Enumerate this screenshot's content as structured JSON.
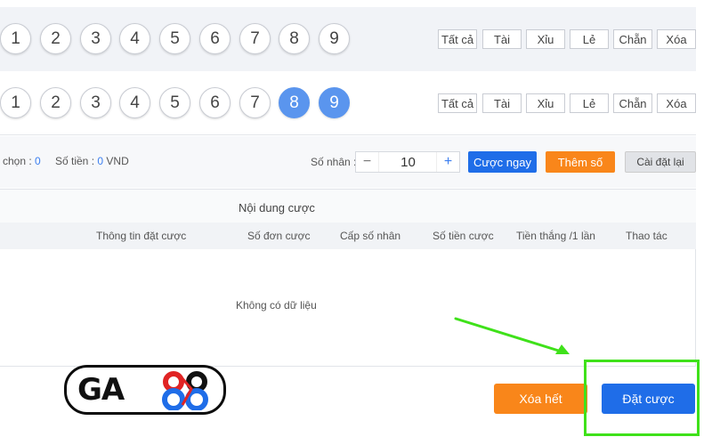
{
  "number_rows": [
    {
      "numbers": [
        "1",
        "2",
        "3",
        "4",
        "5",
        "6",
        "7",
        "8",
        "9"
      ],
      "selected": [],
      "quick_buttons": [
        "Tất cả",
        "Tài",
        "Xỉu",
        "Lẻ",
        "Chẵn",
        "Xóa"
      ]
    },
    {
      "numbers": [
        "1",
        "2",
        "3",
        "4",
        "5",
        "6",
        "7",
        "8",
        "9"
      ],
      "selected": [
        "8",
        "9"
      ],
      "quick_buttons": [
        "Tất cả",
        "Tài",
        "Xỉu",
        "Lẻ",
        "Chẵn",
        "Xóa"
      ]
    }
  ],
  "controls": {
    "chon_label": "chọn : ",
    "chon_value": "0",
    "so_tien_label": "Số tiền : ",
    "so_tien_value": "0",
    "so_tien_unit": " VND",
    "multiplier_label": "Số nhân :",
    "multiplier_value": "10",
    "minus": "−",
    "plus": "+",
    "bet_now": "Cược ngay",
    "add_numbers": "Thêm số",
    "reset": "Cài đặt lại"
  },
  "bet_panel": {
    "title": "Nội dung cược",
    "columns": [
      "Thông tin đặt cược",
      "Số đơn cược",
      "Cấp số nhân",
      "Số tiền cược",
      "Tiền thắng /1 lần",
      "Thao tác"
    ],
    "empty_text": "Không có dữ liệu"
  },
  "footer": {
    "clear_all": "Xóa hết",
    "place_bet": "Đặt cược"
  },
  "logo": {
    "text": "GA",
    "accent_colors": {
      "blue": "#1f6de8",
      "red": "#e02424"
    }
  },
  "colors": {
    "selected_ball": "#5a95ee",
    "primary_button": "#1f6de8",
    "orange_button": "#f9861a",
    "highlight": "#3fe11a"
  }
}
